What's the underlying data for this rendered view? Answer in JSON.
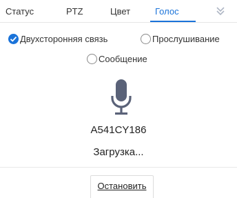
{
  "tabs": [
    {
      "label": "Статус",
      "active": false
    },
    {
      "label": "PTZ",
      "active": false
    },
    {
      "label": "Цвет",
      "active": false
    },
    {
      "label": "Голос",
      "active": true
    }
  ],
  "more_icon": "double-chevron-down-icon",
  "mode_options": [
    {
      "label": "Двухсторонняя связь",
      "checked": true
    },
    {
      "label": "Прослушивание",
      "checked": false
    },
    {
      "label": "Сообщение",
      "checked": false
    }
  ],
  "mic_icon": "microphone-icon",
  "device_id": "A541CY186",
  "status": "Загрузка...",
  "stop_button": "Остановить",
  "colors": {
    "accent": "#1a73d9",
    "mic": "#5a6278",
    "text": "#333333"
  }
}
